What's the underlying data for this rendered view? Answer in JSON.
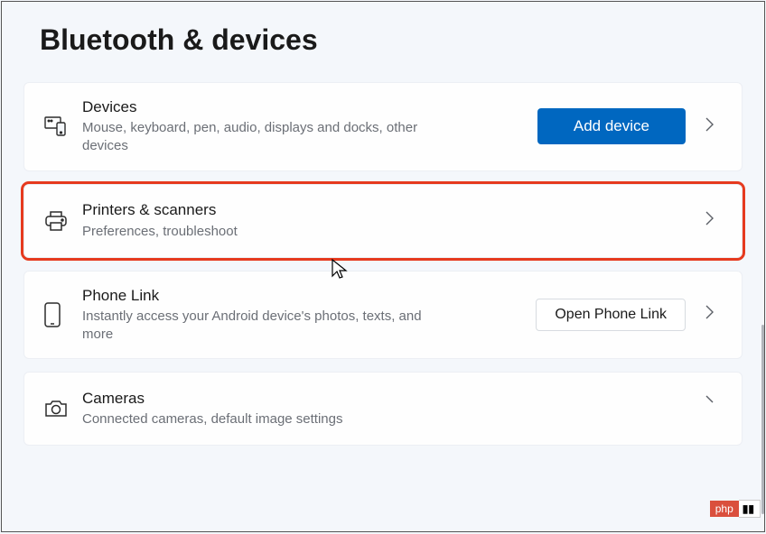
{
  "page": {
    "title": "Bluetooth & devices"
  },
  "cards": {
    "devices": {
      "title": "Devices",
      "sub": "Mouse, keyboard, pen, audio, displays and docks, other devices",
      "action": "Add device"
    },
    "printers": {
      "title": "Printers & scanners",
      "sub": "Preferences, troubleshoot"
    },
    "phone": {
      "title": "Phone Link",
      "sub": "Instantly access your Android device's photos, texts, and more",
      "action": "Open Phone Link"
    },
    "cameras": {
      "title": "Cameras",
      "sub": "Connected cameras, default image settings"
    }
  },
  "watermark": {
    "left": "php",
    "right": "▮▮"
  }
}
